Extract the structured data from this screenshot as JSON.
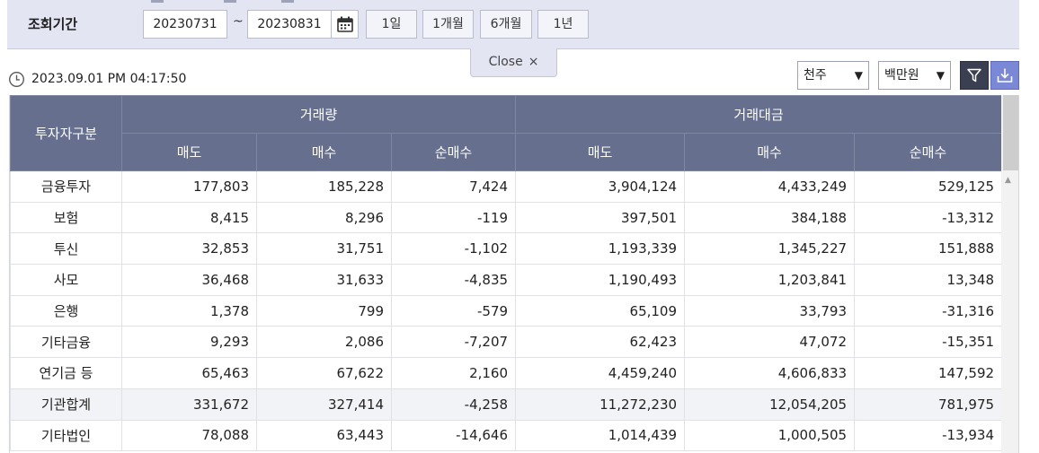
{
  "filter": {
    "period_label": "조회기간",
    "start_date": "20230731",
    "separator": "~",
    "end_date": "20230831",
    "range_buttons": [
      "1일",
      "1개월",
      "6개월",
      "1년"
    ],
    "close_label": "Close",
    "close_symbol": "×"
  },
  "status": {
    "timestamp": "2023.09.01 PM 04:17:50",
    "unit_select": "천주",
    "amount_select": "백만원",
    "dropdown_arrow": "▼"
  },
  "table": {
    "investor_header": "투자자구분",
    "group_headers": [
      "거래량",
      "거래대금"
    ],
    "sub_headers": [
      "매도",
      "매수",
      "순매수",
      "매도",
      "매수",
      "순매수"
    ],
    "rows": [
      {
        "label": "금융투자",
        "values": [
          "177,803",
          "185,228",
          "7,424",
          "3,904,124",
          "4,433,249",
          "529,125"
        ],
        "subtotal": false
      },
      {
        "label": "보험",
        "values": [
          "8,415",
          "8,296",
          "-119",
          "397,501",
          "384,188",
          "-13,312"
        ],
        "subtotal": false
      },
      {
        "label": "투신",
        "values": [
          "32,853",
          "31,751",
          "-1,102",
          "1,193,339",
          "1,345,227",
          "151,888"
        ],
        "subtotal": false
      },
      {
        "label": "사모",
        "values": [
          "36,468",
          "31,633",
          "-4,835",
          "1,190,493",
          "1,203,841",
          "13,348"
        ],
        "subtotal": false
      },
      {
        "label": "은행",
        "values": [
          "1,378",
          "799",
          "-579",
          "65,109",
          "33,793",
          "-31,316"
        ],
        "subtotal": false
      },
      {
        "label": "기타금융",
        "values": [
          "9,293",
          "2,086",
          "-7,207",
          "62,423",
          "47,072",
          "-15,351"
        ],
        "subtotal": false
      },
      {
        "label": "연기금 등",
        "values": [
          "65,463",
          "67,622",
          "2,160",
          "4,459,240",
          "4,606,833",
          "147,592"
        ],
        "subtotal": false
      },
      {
        "label": "기관합계",
        "values": [
          "331,672",
          "327,414",
          "-4,258",
          "11,272,230",
          "12,054,205",
          "781,975"
        ],
        "subtotal": true
      },
      {
        "label": "기타법인",
        "values": [
          "78,088",
          "63,443",
          "-14,646",
          "1,014,439",
          "1,000,505",
          "-13,934"
        ],
        "subtotal": false
      }
    ]
  },
  "colors": {
    "header_bg": "#666f8e",
    "filter_bar_bg": "#e3e5f3",
    "download_button": "#7b88d6",
    "filter_button": "#3a3f51"
  },
  "icons": {
    "calendar": "calendar-icon",
    "clock": "clock-icon",
    "filter": "filter-icon",
    "download": "download-icon",
    "close": "close-icon"
  }
}
